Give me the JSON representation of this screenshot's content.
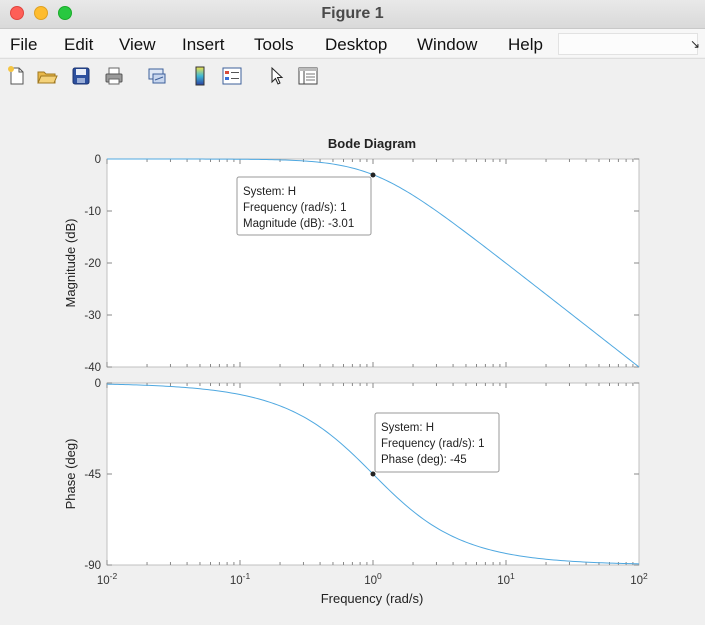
{
  "window": {
    "title": "Figure 1"
  },
  "menu": [
    "File",
    "Edit",
    "View",
    "Insert",
    "Tools",
    "Desktop",
    "Window",
    "Help"
  ],
  "toolbar": {
    "icons": [
      "new-file-icon",
      "open-folder-icon",
      "save-icon",
      "print-icon",
      "link-plot-icon",
      "colorbar-icon",
      "legend-icon",
      "pointer-icon",
      "property-inspector-icon"
    ]
  },
  "plot": {
    "title": "Bode Diagram",
    "xlabel": "Frequency  (rad/s)",
    "x_ticks": [
      {
        "base": "10",
        "exp": "-2"
      },
      {
        "base": "10",
        "exp": "-1"
      },
      {
        "base": "10",
        "exp": "0"
      },
      {
        "base": "10",
        "exp": "1"
      },
      {
        "base": "10",
        "exp": "2"
      }
    ],
    "magnitude": {
      "ylabel": "Magnitude (dB)",
      "y_ticks": [
        "0",
        "-10",
        "-20",
        "-30",
        "-40"
      ]
    },
    "phase": {
      "ylabel": "Phase (deg)",
      "y_ticks": [
        "0",
        "-45",
        "-90"
      ]
    },
    "datatip_mag": {
      "line1": "System: H",
      "line2": "Frequency (rad/s): 1",
      "line3": "Magnitude (dB): -3.01"
    },
    "datatip_phase": {
      "line1": "System: H",
      "line2": "Frequency (rad/s): 1",
      "line3": "Phase (deg): -45"
    },
    "line_color": "#4fa8e0"
  },
  "chart_data": {
    "type": "line",
    "title": "Bode Diagram",
    "xlabel": "Frequency  (rad/s)",
    "xscale": "log",
    "xlim": [
      0.01,
      100
    ],
    "subplots": [
      {
        "ylabel": "Magnitude (dB)",
        "ylim": [
          -40,
          0
        ],
        "x": [
          0.01,
          0.03,
          0.1,
          0.3,
          0.5,
          1,
          2,
          3,
          10,
          30,
          100
        ],
        "values": [
          0,
          -0.004,
          -0.04,
          -0.37,
          -0.97,
          -3.01,
          -6.99,
          -10.0,
          -20.04,
          -29.54,
          -40.0
        ]
      },
      {
        "ylabel": "Phase (deg)",
        "ylim": [
          -90,
          0
        ],
        "x": [
          0.01,
          0.03,
          0.1,
          0.3,
          0.5,
          1,
          2,
          3,
          10,
          30,
          100
        ],
        "values": [
          -0.57,
          -1.72,
          -5.71,
          -16.7,
          -26.57,
          -45,
          -63.43,
          -71.57,
          -84.29,
          -88.09,
          -89.43
        ]
      }
    ],
    "grid": false
  }
}
